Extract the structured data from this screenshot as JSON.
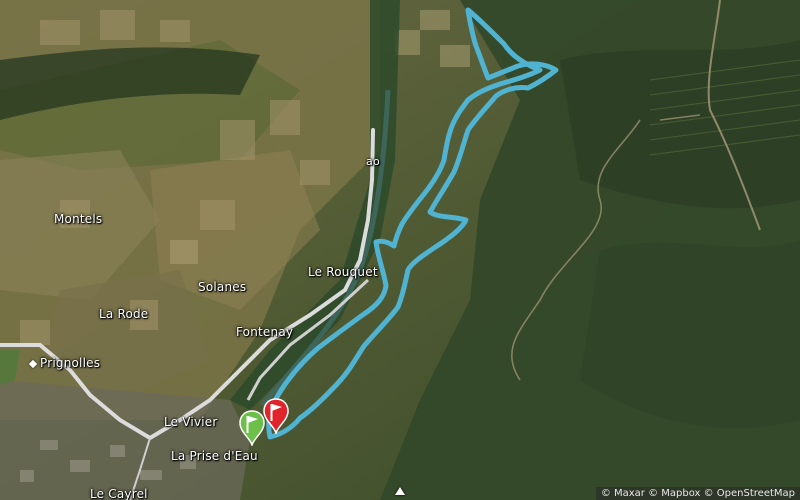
{
  "map": {
    "places": {
      "montels": "Montels",
      "solanes": "Solanes",
      "la_rode": "La Rode",
      "fontenay": "Fontenay",
      "le_rouquet": "Le Rouquet",
      "prignolles": "Prignolles",
      "le_vivier": "Le Vivier",
      "la_prise_d_eau": "La Prise d'Eau",
      "le_cayrel": "Le Cayrel",
      "road_label": "ao"
    },
    "attribution": "© Maxar © Mapbox © OpenStreetMap",
    "route_color": "#4fb3d1",
    "start_marker_color": "#6cc04a",
    "end_marker_color": "#e0242b",
    "icons": {
      "start": "start-flag-marker-icon",
      "end": "finish-flag-marker-icon",
      "village": "village-dot-icon",
      "peak": "summit-triangle-icon"
    }
  }
}
